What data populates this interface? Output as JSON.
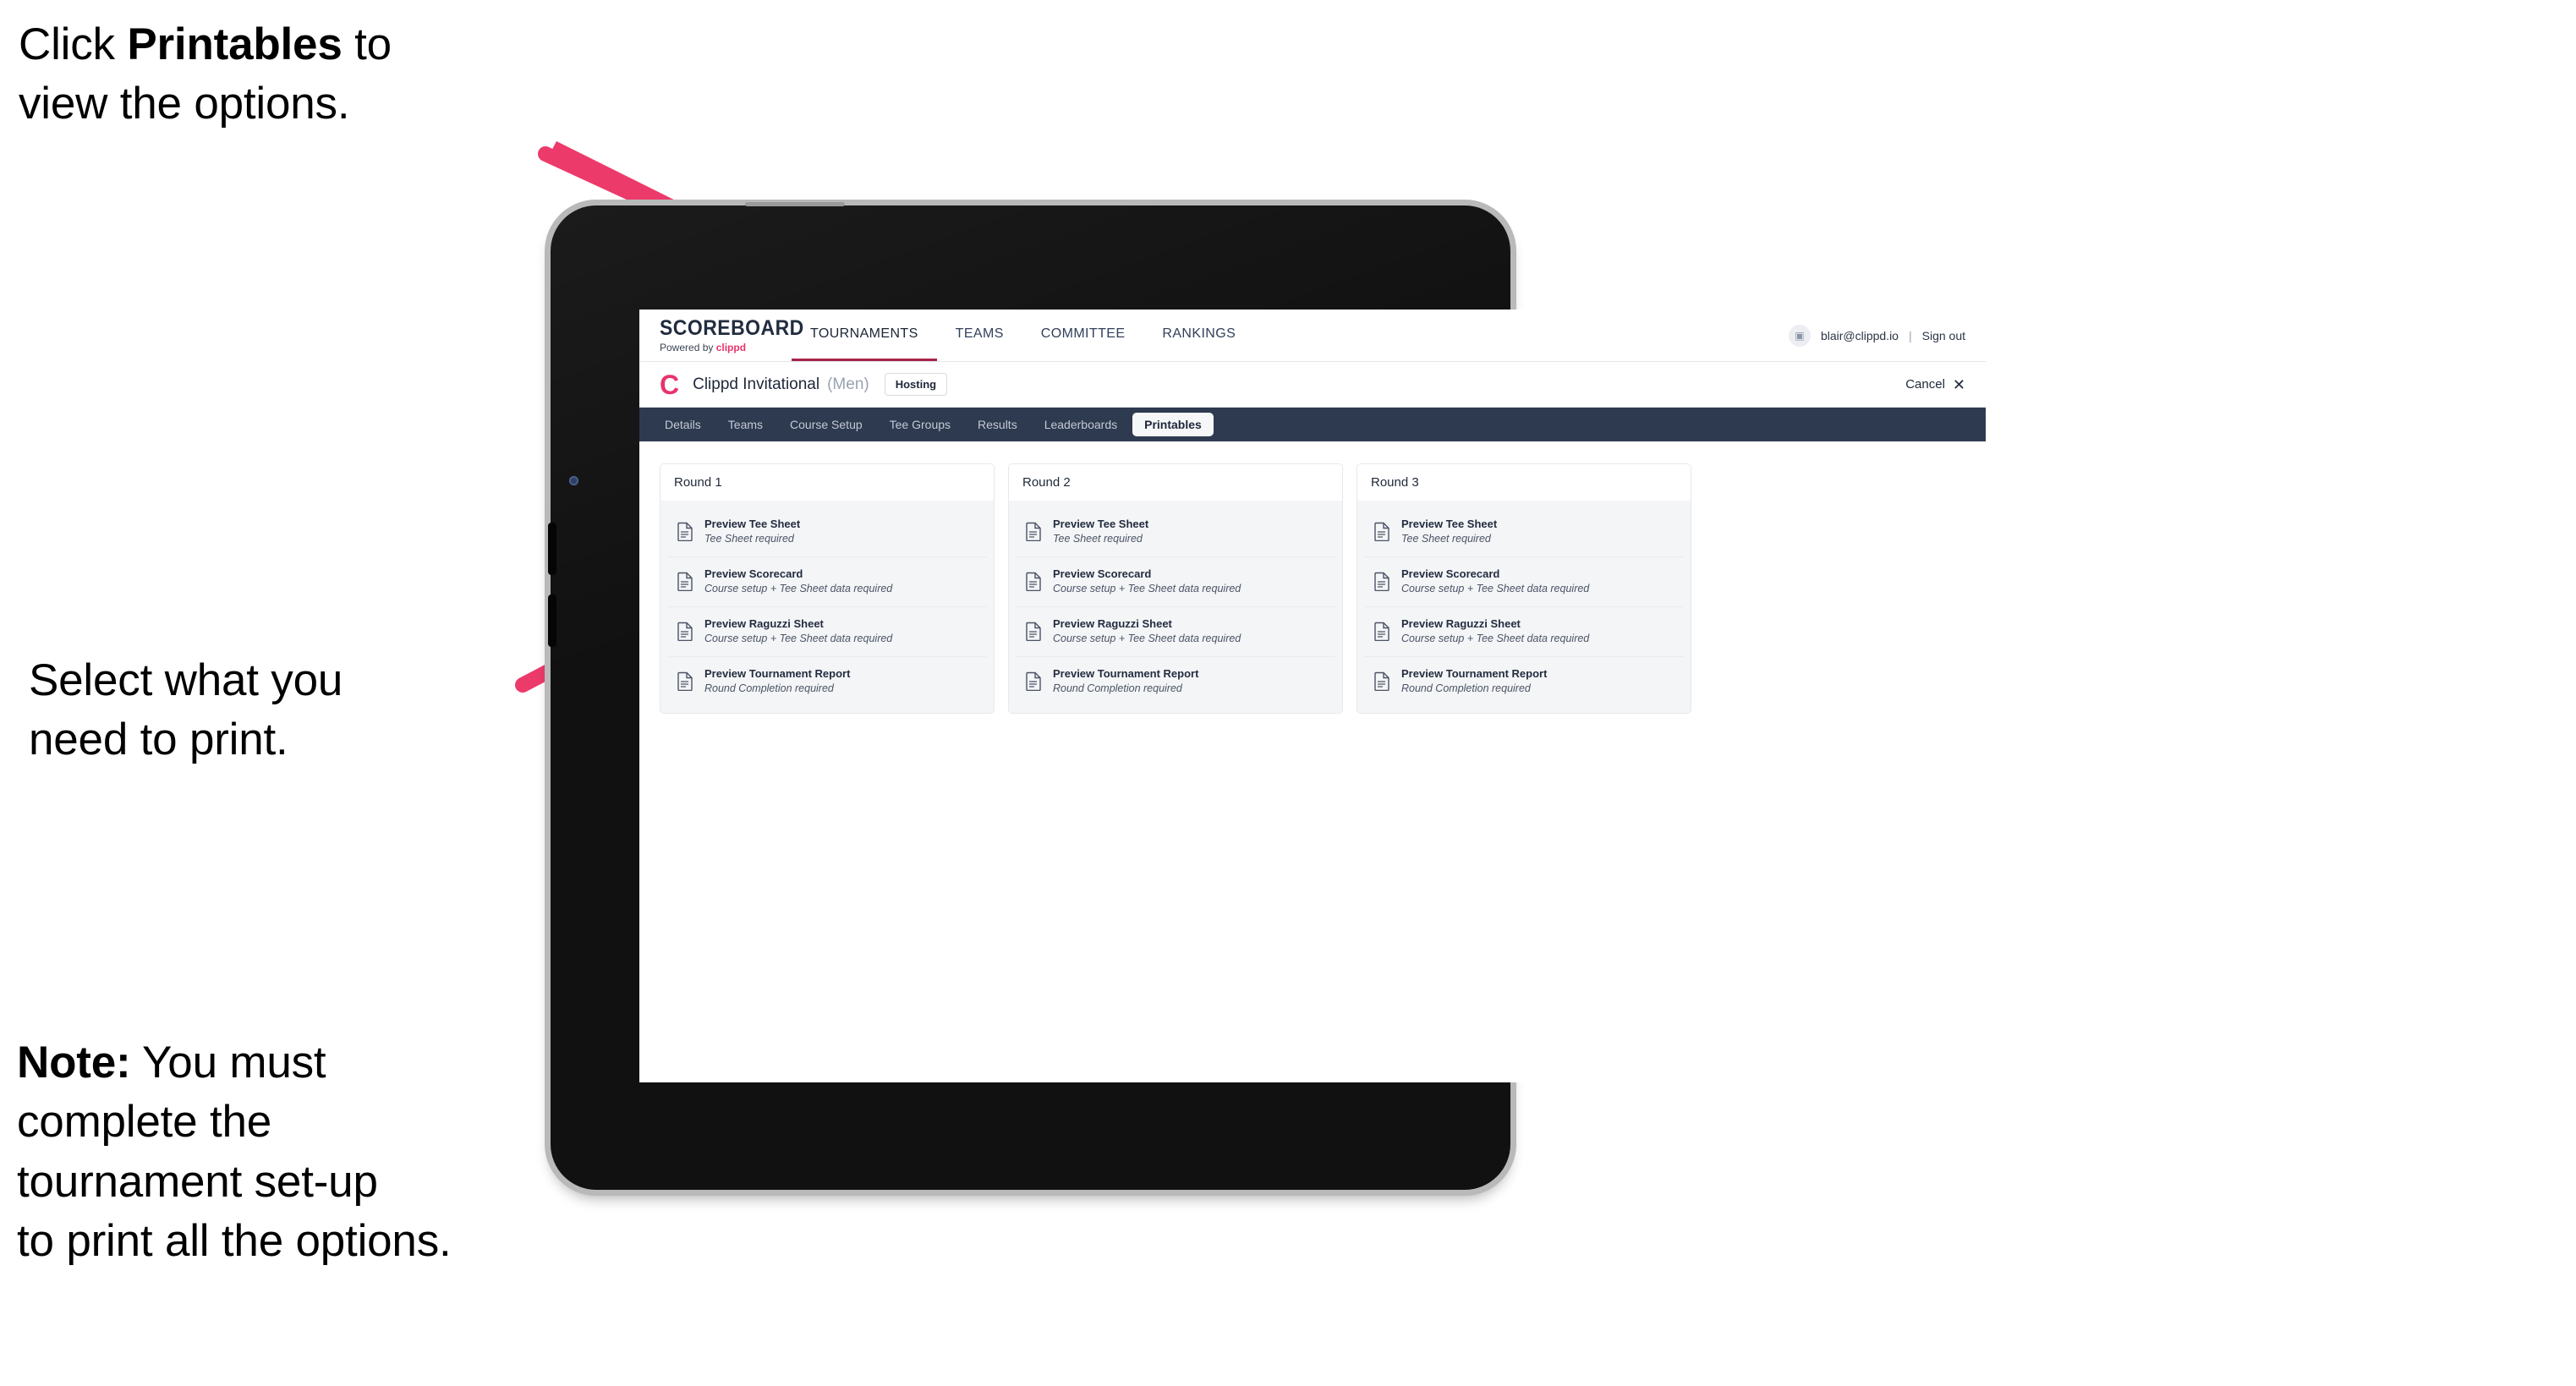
{
  "annotations": {
    "click_printables": "Click ",
    "click_printables_bold": "Printables",
    "click_printables_tail": " to\nview the options.",
    "select_print": "Select what you\n need to print.",
    "note_label": "Note:",
    "note_body": " You must\ncomplete the\ntournament set-up\nto print all the options."
  },
  "accent_colors": {
    "arrow_pink": "#ec3a6b",
    "brand_pink": "#e8336c",
    "nav_dark": "#2e3a4f",
    "active_underline": "#a62448"
  },
  "app": {
    "logo": {
      "wordmark": "SCOREBOARD",
      "powered_by": "Powered by ",
      "brand": "clippd"
    },
    "top_nav": [
      {
        "label": "TOURNAMENTS",
        "active": true
      },
      {
        "label": "TEAMS",
        "active": false
      },
      {
        "label": "COMMITTEE",
        "active": false
      },
      {
        "label": "RANKINGS",
        "active": false
      }
    ],
    "account": {
      "avatar_glyph": "▣",
      "email": "blair@clippd.io",
      "separator": "|",
      "sign_out": "Sign out"
    },
    "tournament_bar": {
      "brand_initial": "C",
      "name": "Clippd Invitational",
      "gender": "(Men)",
      "status_badge": "Hosting",
      "cancel_label": "Cancel",
      "cancel_icon": "✕"
    },
    "tabs": [
      {
        "label": "Details",
        "active": false
      },
      {
        "label": "Teams",
        "active": false
      },
      {
        "label": "Course Setup",
        "active": false
      },
      {
        "label": "Tee Groups",
        "active": false
      },
      {
        "label": "Results",
        "active": false
      },
      {
        "label": "Leaderboards",
        "active": false
      },
      {
        "label": "Printables",
        "active": true
      }
    ],
    "rounds": [
      {
        "title": "Round 1",
        "items": [
          {
            "title": "Preview Tee Sheet",
            "subtitle": "Tee Sheet required"
          },
          {
            "title": "Preview Scorecard",
            "subtitle": "Course setup + Tee Sheet data required"
          },
          {
            "title": "Preview Raguzzi Sheet",
            "subtitle": "Course setup + Tee Sheet data required"
          },
          {
            "title": "Preview Tournament Report",
            "subtitle": "Round Completion required"
          }
        ]
      },
      {
        "title": "Round 2",
        "items": [
          {
            "title": "Preview Tee Sheet",
            "subtitle": "Tee Sheet required"
          },
          {
            "title": "Preview Scorecard",
            "subtitle": "Course setup + Tee Sheet data required"
          },
          {
            "title": "Preview Raguzzi Sheet",
            "subtitle": "Course setup + Tee Sheet data required"
          },
          {
            "title": "Preview Tournament Report",
            "subtitle": "Round Completion required"
          }
        ]
      },
      {
        "title": "Round 3",
        "items": [
          {
            "title": "Preview Tee Sheet",
            "subtitle": "Tee Sheet required"
          },
          {
            "title": "Preview Scorecard",
            "subtitle": "Course setup + Tee Sheet data required"
          },
          {
            "title": "Preview Raguzzi Sheet",
            "subtitle": "Course setup + Tee Sheet data required"
          },
          {
            "title": "Preview Tournament Report",
            "subtitle": "Round Completion required"
          }
        ]
      }
    ]
  }
}
